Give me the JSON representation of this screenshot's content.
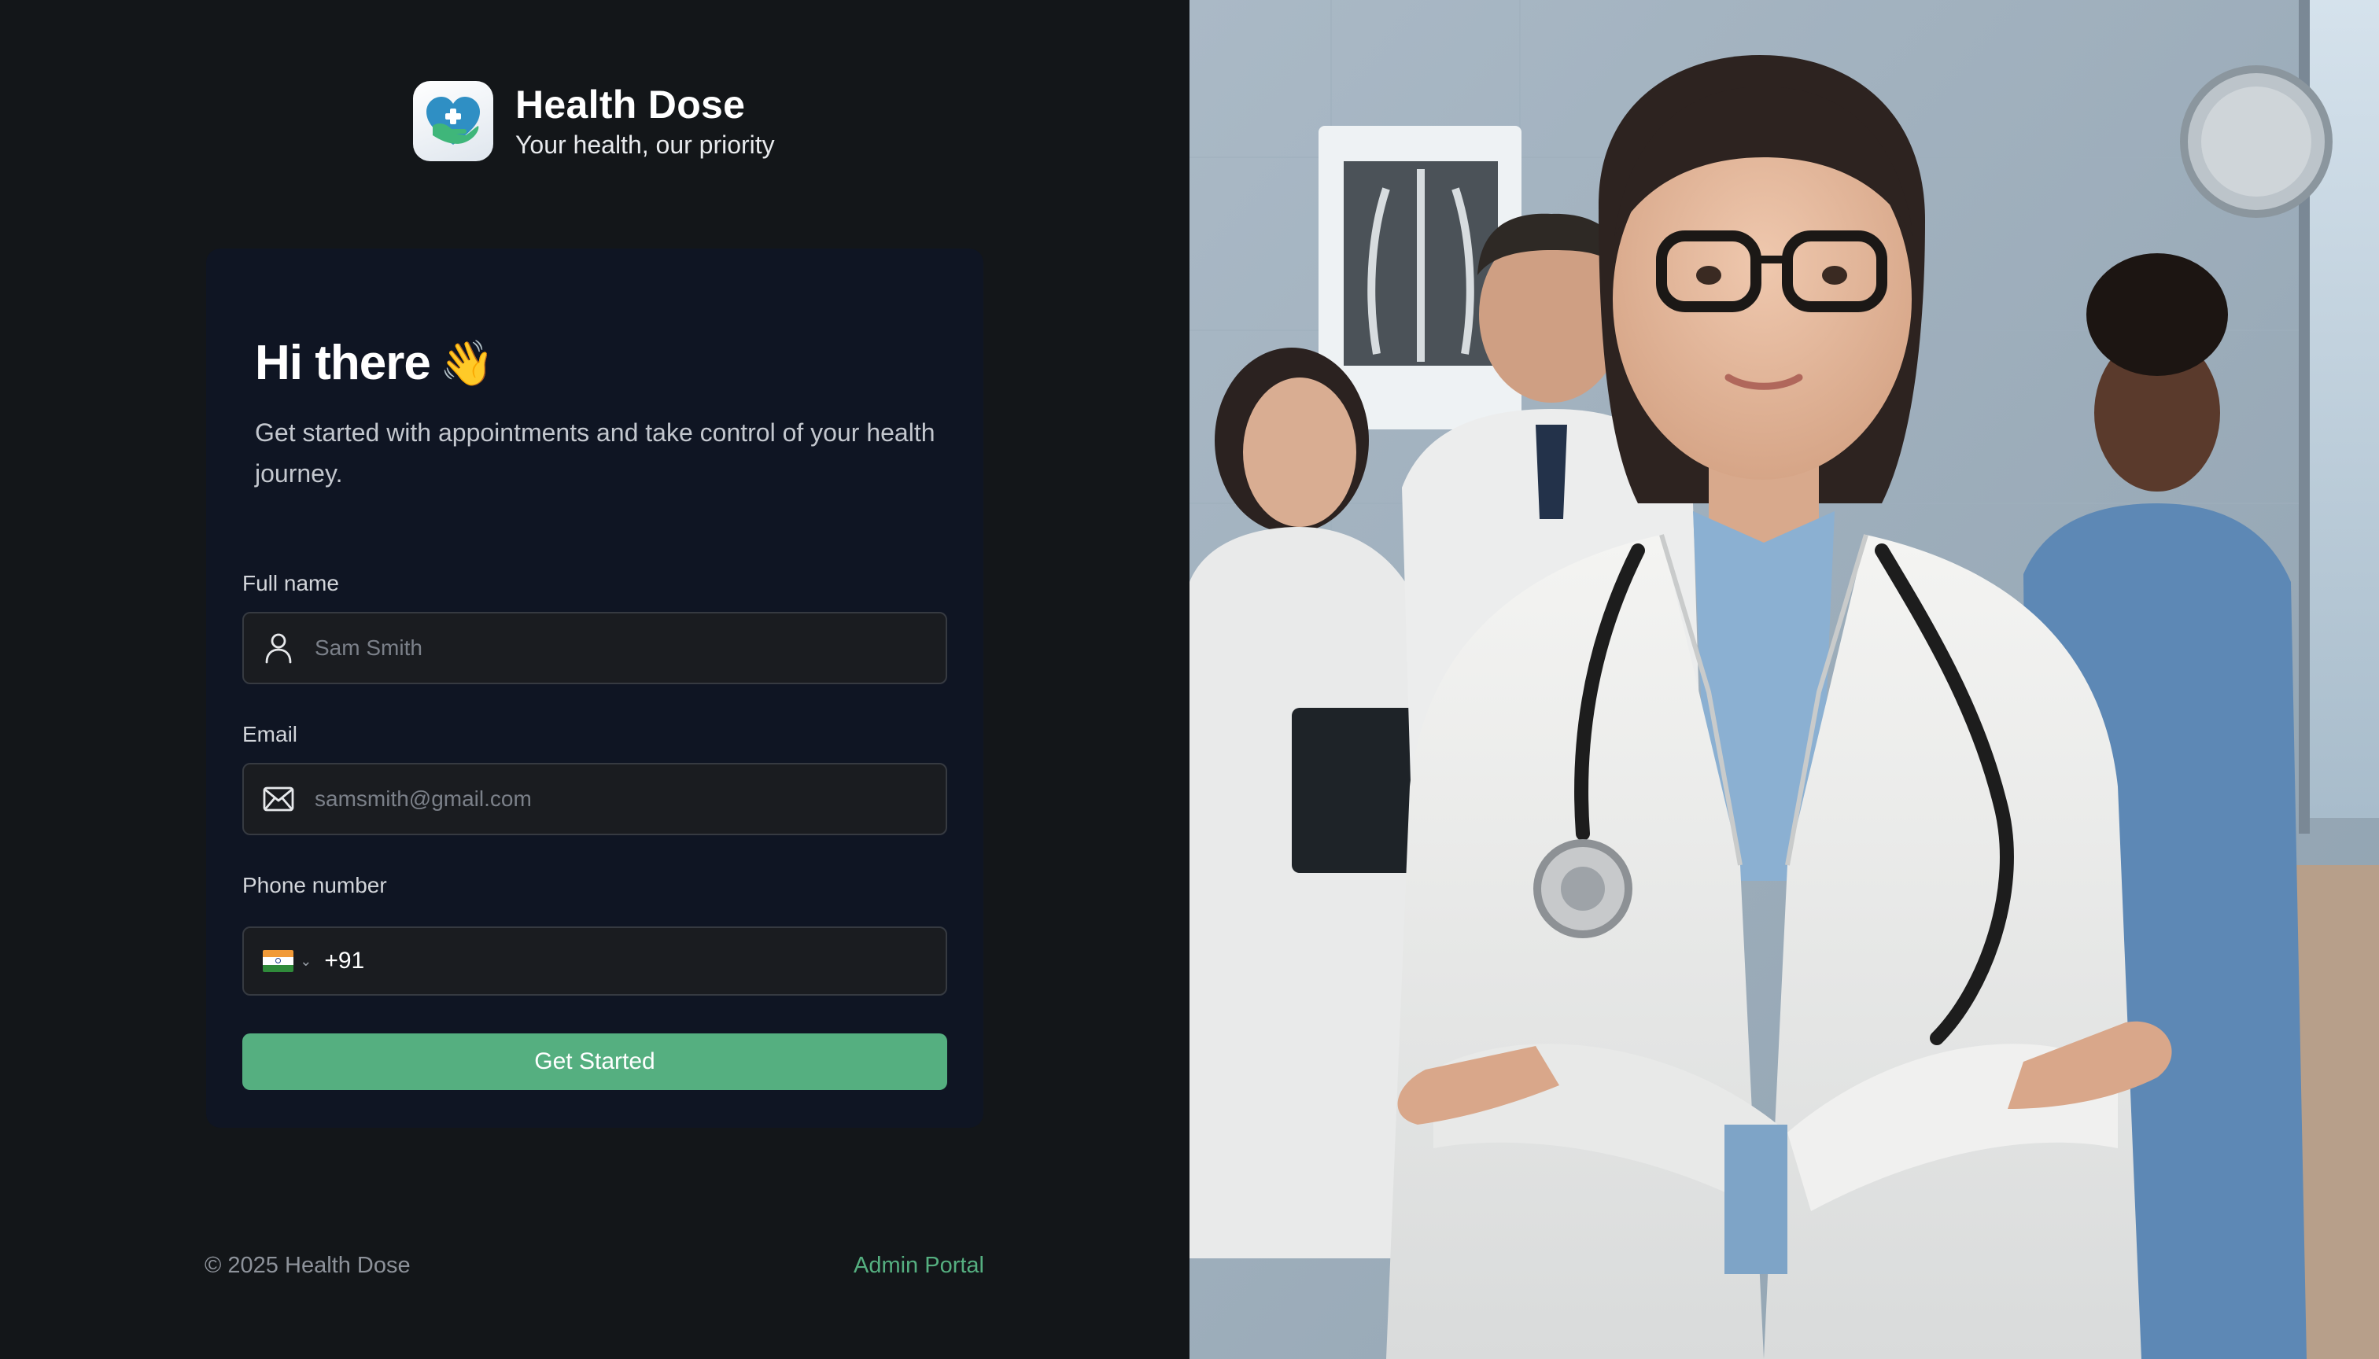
{
  "brand": {
    "name": "Health Dose",
    "tagline": "Your health, our priority",
    "logo_icon": "heart-hand-icon"
  },
  "form": {
    "heading": "Hi there",
    "heading_emoji": "👋",
    "subtitle": "Get started with appointments and take control of your health journey.",
    "full_name": {
      "label": "Full name",
      "placeholder": "Sam Smith",
      "icon": "user-icon"
    },
    "email": {
      "label": "Email",
      "placeholder": "samsmith@gmail.com",
      "icon": "mail-icon"
    },
    "phone": {
      "label": "Phone number",
      "country_flag": "india-flag-icon",
      "dial_code": "+91"
    },
    "submit_label": "Get Started"
  },
  "footer": {
    "copyright": "© 2025 Health Dose",
    "admin_link": "Admin Portal"
  },
  "colors": {
    "background": "#131619",
    "card": "#0f1523",
    "input": "#1a1c20",
    "accent": "#55af80"
  }
}
